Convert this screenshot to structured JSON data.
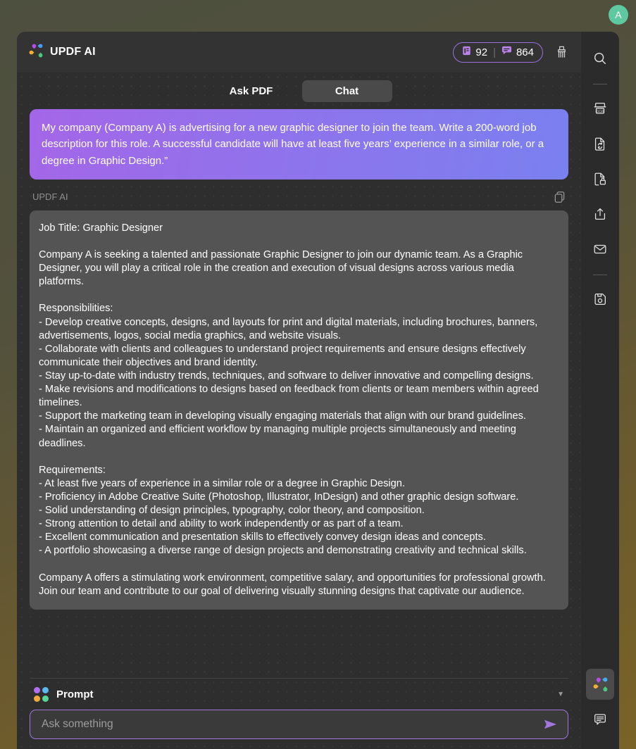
{
  "desktop": {
    "avatar_initial": "A",
    "avatar_color": "#5ec9a0"
  },
  "header": {
    "brand_title": "UPDF AI",
    "logo_icon": "updf-flower-logo-icon",
    "credits": {
      "pages_icon": "document-pages-icon",
      "pages_value": "92",
      "separator": "|",
      "chat_icon": "chat-bubble-icon",
      "chat_value": "864"
    },
    "brush_icon": "brush-cleanup-icon"
  },
  "tabs": [
    {
      "label": "Ask PDF",
      "active": false,
      "name": "tab-ask-pdf"
    },
    {
      "label": "Chat",
      "active": true,
      "name": "tab-chat"
    }
  ],
  "conversation": {
    "user_message": "My company (Company A) is advertising for a new graphic designer to join the team. Write a 200-word job description for this role. A successful candidate will have at least five years’ experience in a similar role, or a degree in Graphic Design.”",
    "assistant_label": "UPDF AI",
    "copy_icon": "copy-icon",
    "assistant_message": "Job Title: Graphic Designer\n\nCompany A is seeking a talented and passionate Graphic Designer to join our dynamic team. As a Graphic Designer, you will play a critical role in the creation and execution of visual designs across various media platforms.\n\nResponsibilities:\n- Develop creative concepts, designs, and layouts for print and digital materials, including brochures, banners, advertisements, logos, social media graphics, and website visuals.\n- Collaborate with clients and colleagues to understand project requirements and ensure designs effectively communicate their objectives and brand identity.\n- Stay up-to-date with industry trends, techniques, and software to deliver innovative and compelling designs.\n- Make revisions and modifications to designs based on feedback from clients or team members within agreed timelines.\n- Support the marketing team in developing visually engaging materials that align with our brand guidelines.\n- Maintain an organized and efficient workflow by managing multiple projects simultaneously and meeting deadlines.\n\nRequirements:\n- At least five years of experience in a similar role or a degree in Graphic Design.\n- Proficiency in Adobe Creative Suite (Photoshop, Illustrator, InDesign) and other graphic design software.\n- Solid understanding of design principles, typography, color theory, and composition.\n- Strong attention to detail and ability to work independently or as part of a team.\n- Excellent communication and presentation skills to effectively convey design ideas and concepts.\n- A portfolio showcasing a diverse range of design projects and demonstrating creativity and technical skills.\n\nCompany A offers a stimulating work environment, competitive salary, and opportunities for professional growth. Join our team and contribute to our goal of delivering visually stunning designs that captivate our audience."
  },
  "prompt": {
    "label": "Prompt",
    "dots_icon": "four-color-dots-icon",
    "dots_colors": [
      "#b06ff0",
      "#5bb8f0",
      "#f0a93a",
      "#5ad69a"
    ],
    "caret_icon": "chevron-down-icon",
    "input_placeholder": "Ask something",
    "input_value": "",
    "send_icon": "send-arrow-icon",
    "accent_color": "#a177dd"
  },
  "toolbar": {
    "items": [
      {
        "name": "tool-search",
        "icon": "search-icon",
        "separator_after": true
      },
      {
        "name": "tool-ocr",
        "icon": "ocr-icon",
        "separator_after": false
      },
      {
        "name": "tool-convert",
        "icon": "convert-document-icon",
        "separator_after": false
      },
      {
        "name": "tool-protect",
        "icon": "lock-document-icon",
        "separator_after": false
      },
      {
        "name": "tool-share",
        "icon": "share-upload-icon",
        "separator_after": false
      },
      {
        "name": "tool-email",
        "icon": "envelope-icon",
        "separator_after": true
      },
      {
        "name": "tool-save",
        "icon": "floppy-save-icon",
        "separator_after": false
      }
    ],
    "bottom_items": [
      {
        "name": "tool-updf-ai",
        "icon": "updf-flower-logo-icon",
        "active": true
      },
      {
        "name": "tool-comment",
        "icon": "comment-bubble-icon",
        "active": false
      }
    ]
  }
}
